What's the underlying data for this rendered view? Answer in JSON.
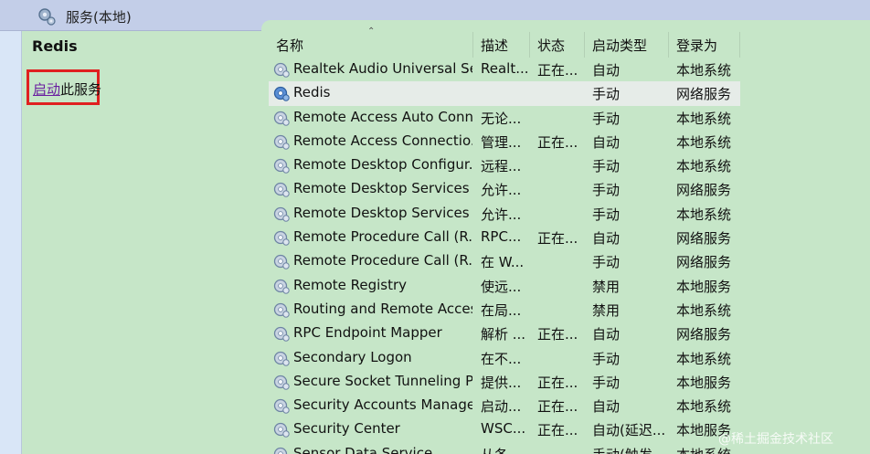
{
  "window": {
    "title": "服务(本地)",
    "icon": "services-gear-icon"
  },
  "left_panel": {
    "service_name": "Redis",
    "action_link": "启动",
    "action_suffix": "此服务"
  },
  "columns": [
    "名称",
    "描述",
    "状态",
    "启动类型",
    "登录为"
  ],
  "services": [
    {
      "name": "Realtek Audio Universal Se...",
      "desc": "Realt...",
      "state": "正在...",
      "startup": "自动",
      "logon": "本地系统",
      "selected": false
    },
    {
      "name": "Redis",
      "desc": "",
      "state": "",
      "startup": "手动",
      "logon": "网络服务",
      "selected": true
    },
    {
      "name": "Remote Access Auto Conn...",
      "desc": "无论...",
      "state": "",
      "startup": "手动",
      "logon": "本地系统",
      "selected": false
    },
    {
      "name": "Remote Access Connectio...",
      "desc": "管理...",
      "state": "正在...",
      "startup": "自动",
      "logon": "本地系统",
      "selected": false
    },
    {
      "name": "Remote Desktop Configur...",
      "desc": "远程...",
      "state": "",
      "startup": "手动",
      "logon": "本地系统",
      "selected": false
    },
    {
      "name": "Remote Desktop Services",
      "desc": "允许...",
      "state": "",
      "startup": "手动",
      "logon": "网络服务",
      "selected": false
    },
    {
      "name": "Remote Desktop Services ...",
      "desc": "允许...",
      "state": "",
      "startup": "手动",
      "logon": "本地系统",
      "selected": false
    },
    {
      "name": "Remote Procedure Call (R...",
      "desc": "RPC...",
      "state": "正在...",
      "startup": "自动",
      "logon": "网络服务",
      "selected": false
    },
    {
      "name": "Remote Procedure Call (R...",
      "desc": "在 W...",
      "state": "",
      "startup": "手动",
      "logon": "网络服务",
      "selected": false
    },
    {
      "name": "Remote Registry",
      "desc": "使远...",
      "state": "",
      "startup": "禁用",
      "logon": "本地服务",
      "selected": false
    },
    {
      "name": "Routing and Remote Access",
      "desc": "在局...",
      "state": "",
      "startup": "禁用",
      "logon": "本地系统",
      "selected": false
    },
    {
      "name": "RPC Endpoint Mapper",
      "desc": "解析 ...",
      "state": "正在...",
      "startup": "自动",
      "logon": "网络服务",
      "selected": false
    },
    {
      "name": "Secondary Logon",
      "desc": "在不...",
      "state": "",
      "startup": "手动",
      "logon": "本地系统",
      "selected": false
    },
    {
      "name": "Secure Socket Tunneling P...",
      "desc": "提供...",
      "state": "正在...",
      "startup": "手动",
      "logon": "本地服务",
      "selected": false
    },
    {
      "name": "Security Accounts Manager",
      "desc": "启动...",
      "state": "正在...",
      "startup": "自动",
      "logon": "本地系统",
      "selected": false
    },
    {
      "name": "Security Center",
      "desc": "WSC...",
      "state": "正在...",
      "startup": "自动(延迟...",
      "logon": "本地服务",
      "selected": false
    },
    {
      "name": "Sensor Data Service",
      "desc": "从各...",
      "state": "",
      "startup": "手动(触发...",
      "logon": "本地系统",
      "selected": false
    }
  ],
  "watermark": "@稀土掘金技术社区",
  "colors": {
    "panel_bg": "#c6e6c8",
    "header_bg": "#c3cee8",
    "highlight_border": "#e02020",
    "link": "#6a1ea0",
    "selected_row": "#e6ece8"
  }
}
